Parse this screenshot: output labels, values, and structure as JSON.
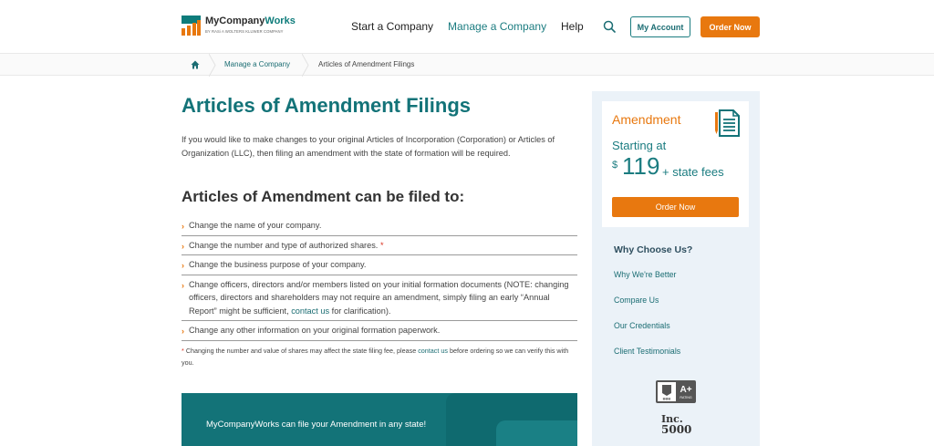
{
  "header": {
    "logo": {
      "name_a": "MyCompany",
      "name_b": "Works",
      "tagline": "BY RASi A WOLTERS KLUWER COMPANY",
      "colors": {
        "orange": "#e8780f",
        "teal": "#0e7c7b"
      }
    },
    "nav": [
      {
        "label": "Start a Company"
      },
      {
        "label": "Manage a Company"
      },
      {
        "label": "Help"
      }
    ],
    "search_icon": "search-icon",
    "account_label": "My Account",
    "order_label": "Order Now"
  },
  "breadcrumb": {
    "home_icon": "home-icon",
    "items": [
      "Manage a Company",
      "Articles of Amendment Filings"
    ]
  },
  "main": {
    "title": "Articles of Amendment Filings",
    "intro": "If you would like to make changes to your original Articles of Incorporation (Corporation) or Articles of Organization (LLC), then filing an amendment with the state of formation will be required.",
    "subtitle": "Articles of Amendment can be filed to:",
    "list": [
      {
        "text": "Change the name of your company."
      },
      {
        "text": "Change the number and type of authorized shares.",
        "star": "*"
      },
      {
        "text": "Change the business purpose of your company."
      },
      {
        "text_a": "Change officers, directors and/or members listed on your initial formation documents (NOTE: changing officers, directors and shareholders may not require an amendment, simply filing an early “Annual Report” might be sufficient,",
        "link": "contact us",
        "text_b": "for clarification)."
      },
      {
        "text": "Change any other information on your original formation paperwork."
      }
    ],
    "footnote": {
      "star": "*",
      "text_a": "Changing the number and value of shares may affect the state filing fee, please",
      "link": "contact us",
      "text_b": "before ordering so we can verify this with you."
    },
    "banner": "MyCompanyWorks can file your Amendment in any state!"
  },
  "sidebar": {
    "card": {
      "title": "Amendment",
      "starting": "Starting at",
      "currency": "$",
      "price": "119",
      "fees": "+ state fees",
      "button": "Order Now",
      "icon": "document-icon"
    },
    "why_title": "Why Choose Us?",
    "why_links": [
      "Why We're Better",
      "Compare Us",
      "Our Credentials",
      "Client Testimonials"
    ],
    "bbb": {
      "abbr": "BBB",
      "rating": "A+",
      "rating_label": "RATING"
    },
    "inc": {
      "brand": "Inc.",
      "number": "5000"
    }
  },
  "colors": {
    "teal": "#137378",
    "orange": "#e8780f",
    "sidebar_bg": "#ebf2f8"
  }
}
